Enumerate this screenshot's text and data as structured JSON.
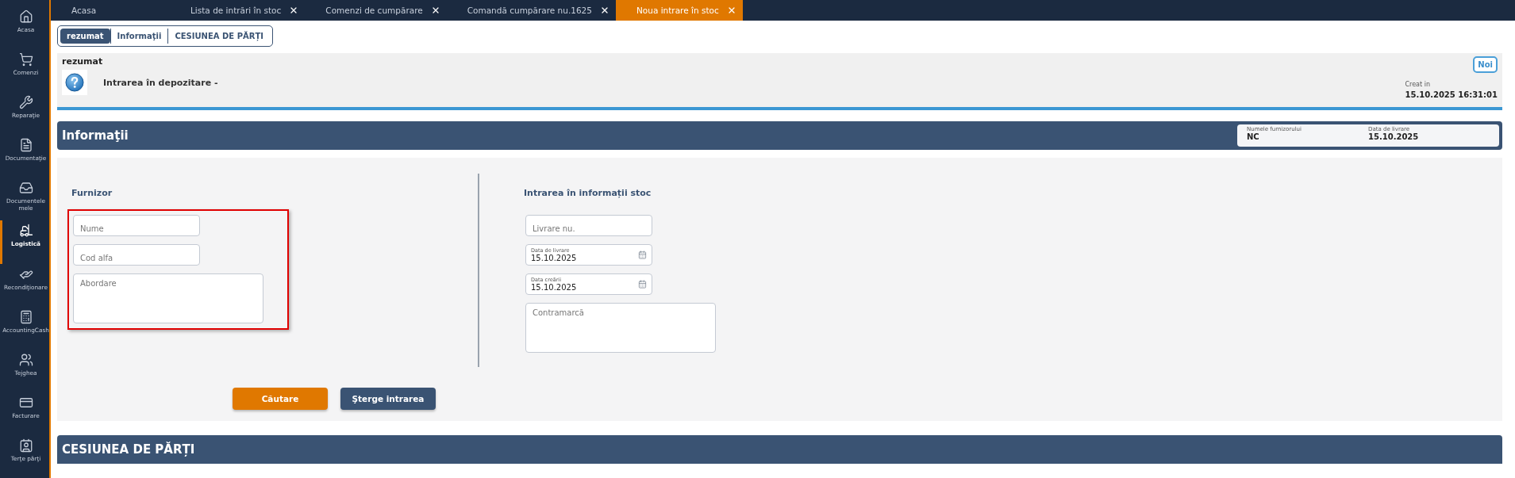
{
  "sidebar": {
    "items": [
      {
        "label": "Acasa",
        "selected": false
      },
      {
        "label": "Comenzi",
        "selected": false
      },
      {
        "label": "Reparaţie",
        "selected": false
      },
      {
        "label": "Documentaţie",
        "selected": false
      },
      {
        "label": "Documentele mele",
        "selected": false
      },
      {
        "label": "Logistică",
        "selected": true
      },
      {
        "label": "Recondiţionare",
        "selected": false
      },
      {
        "label": "AccountingCash",
        "selected": false
      },
      {
        "label": "Tejghea",
        "selected": false
      },
      {
        "label": "Facturare",
        "selected": false
      },
      {
        "label": "Terţe părţi",
        "selected": false
      }
    ]
  },
  "tabs": [
    {
      "label": "Acasa",
      "closable": false,
      "selected": false
    },
    {
      "label": "Lista de intrări în stoc",
      "closable": true,
      "selected": false
    },
    {
      "label": "Comenzi de cumpărare",
      "closable": true,
      "selected": false
    },
    {
      "label": "Comandă cumpărare nu.1625",
      "closable": true,
      "selected": false
    },
    {
      "label": "Noua intrare în stoc",
      "closable": true,
      "selected": true
    }
  ],
  "section_tabs": [
    {
      "label": "rezumat",
      "selected": true
    },
    {
      "label": "Informaţii",
      "selected": false
    },
    {
      "label": "CESIUNEA DE PĂRȚI",
      "selected": false
    }
  ],
  "summary": {
    "title": "rezumat",
    "heading": "Intrarea în depozitare -",
    "badge": "Noi",
    "created_label": "Creat in",
    "created_value": "15.10.2025 16:31:01"
  },
  "info": {
    "title": "Informaţii",
    "fields": [
      {
        "label": "Numele furnizorului",
        "value": "NC"
      },
      {
        "label": "Data de livrare",
        "value": "15.10.2025"
      }
    ]
  },
  "form": {
    "left": {
      "title": "Furnizor",
      "highlighted": true,
      "fields": [
        {
          "kind": "input",
          "placeholder": "Nume"
        },
        {
          "kind": "input",
          "placeholder": "Cod alfa"
        },
        {
          "kind": "textarea",
          "placeholder": "Abordare"
        }
      ]
    },
    "right": {
      "title": "Intrarea în informații stoc",
      "highlighted": false,
      "fields": [
        {
          "kind": "input",
          "placeholder": "Livrare nu."
        },
        {
          "kind": "date",
          "label": "Data de livrare",
          "value": "15.10.2025"
        },
        {
          "kind": "date",
          "label": "Data creării",
          "value": "15.10.2025"
        },
        {
          "kind": "textarea",
          "placeholder": "Contramarcă"
        }
      ]
    },
    "buttons": [
      {
        "label": "Căutare",
        "kind": "primary"
      },
      {
        "label": "Şterge intrarea",
        "kind": "secondary"
      }
    ]
  },
  "parts": {
    "title": "CESIUNEA DE PĂRȚI"
  }
}
